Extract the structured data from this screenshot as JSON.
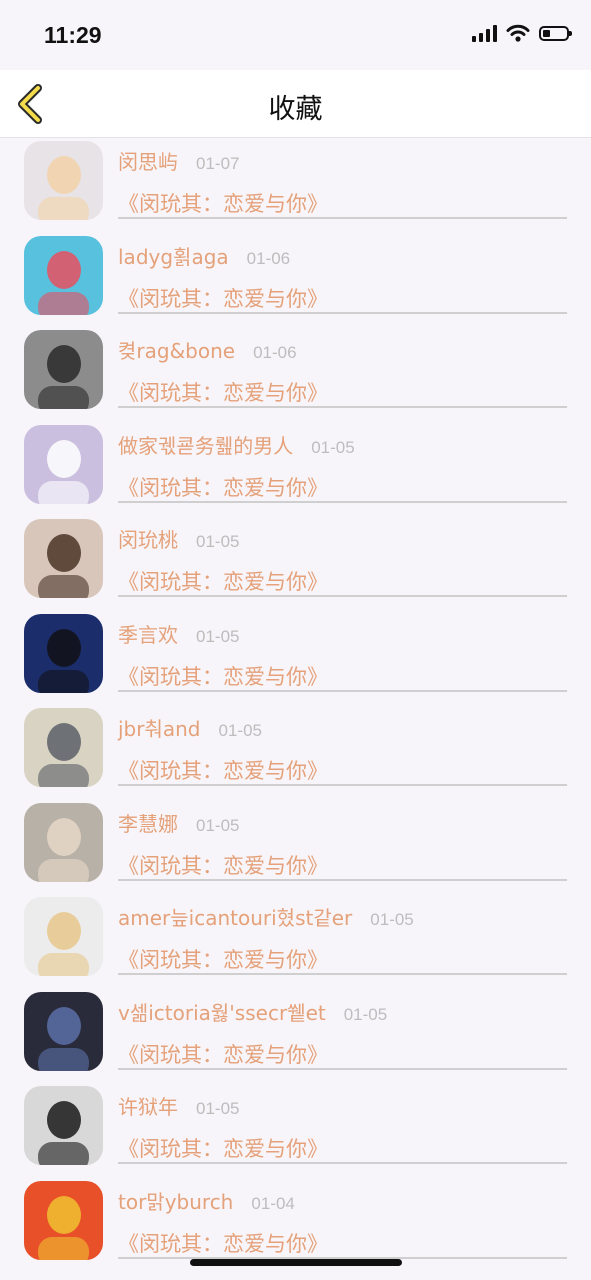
{
  "status_bar": {
    "time": "11:29"
  },
  "nav": {
    "title": "收藏"
  },
  "items": [
    {
      "name": "闵思屿",
      "date": "01-07",
      "title": "《闵玧其：恋爱与你》",
      "avatar": {
        "bg": "#e8e3e6",
        "accent": "#f2d2a8"
      }
    },
    {
      "name": "ladyg횕aga",
      "date": "01-06",
      "title": "《闵玧其：恋爱与你》",
      "avatar": {
        "bg": "#57c1de",
        "accent": "#e85060"
      }
    },
    {
      "name": "켲rag&bone",
      "date": "01-06",
      "title": "《闵玧其：恋爱与你》",
      "avatar": {
        "bg": "#8c8c8c",
        "accent": "#2a2a2a"
      }
    },
    {
      "name": "做家궧쿋务뤮的男人",
      "date": "01-05",
      "title": "《闵玧其：恋爱与你》",
      "avatar": {
        "bg": "#cbbfe0",
        "accent": "#ffffff"
      }
    },
    {
      "name": "闵玧桃",
      "date": "01-05",
      "title": "《闵玧其：恋爱与你》",
      "avatar": {
        "bg": "#d8c6bb",
        "accent": "#4a3426"
      }
    },
    {
      "name": "季言欢",
      "date": "01-05",
      "title": "《闵玧其：恋爱与你》",
      "avatar": {
        "bg": "#1b2d6b",
        "accent": "#101014"
      }
    },
    {
      "name": "jbr춰and",
      "date": "01-05",
      "title": "《闵玧其：恋爱与你》",
      "avatar": {
        "bg": "#d9d3c4",
        "accent": "#5a6068"
      }
    },
    {
      "name": "李慧娜",
      "date": "01-05",
      "title": "《闵玧其：恋爱与你》",
      "avatar": {
        "bg": "#b8b1a8",
        "accent": "#e6d8c8"
      }
    },
    {
      "name": "amer늪icantouri혔st같er",
      "date": "01-05",
      "title": "《闵玧其：恋爱与你》",
      "avatar": {
        "bg": "#ececec",
        "accent": "#e8c88c"
      }
    },
    {
      "name": "v셂ictoria웛'ssecr쒵et",
      "date": "01-05",
      "title": "《闵玧其：恋爱与你》",
      "avatar": {
        "bg": "#2a2b3a",
        "accent": "#5b6fa8"
      }
    },
    {
      "name": "许狱年",
      "date": "01-05",
      "title": "《闵玧其：恋爱与你》",
      "avatar": {
        "bg": "#d8d8d8",
        "accent": "#1a1a1a"
      }
    },
    {
      "name": "tor맑yburch",
      "date": "01-04",
      "title": "《闵玧其：恋爱与你》",
      "avatar": {
        "bg": "#e8502a",
        "accent": "#f0c030"
      }
    }
  ]
}
